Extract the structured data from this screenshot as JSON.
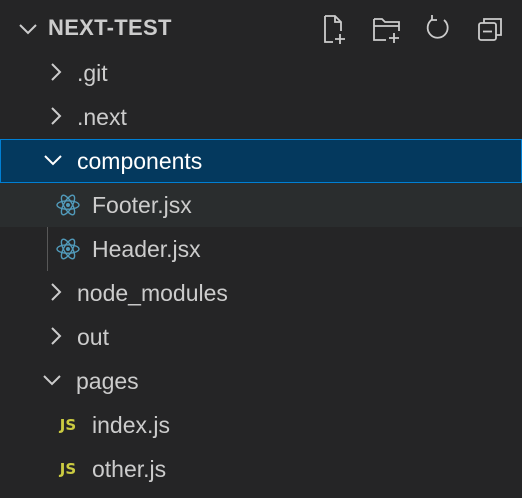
{
  "explorer": {
    "section_title": "NEXT-TEST",
    "actions": [
      {
        "name": "new-file",
        "icon": "new-file-icon"
      },
      {
        "name": "new-folder",
        "icon": "new-folder-icon"
      },
      {
        "name": "refresh",
        "icon": "refresh-icon"
      },
      {
        "name": "collapse-all",
        "icon": "collapse-all-icon"
      }
    ]
  },
  "tree": {
    "git": ".git",
    "next": ".next",
    "components": "components",
    "footer": "Footer.jsx",
    "header": "Header.jsx",
    "node_modules": "node_modules",
    "out": "out",
    "pages": "pages",
    "index": "index.js",
    "other": "other.js",
    "js_badge": "JS"
  },
  "colors": {
    "background": "#252526",
    "selected_background": "#04395e",
    "selected_border": "#007fd4",
    "react_icon": "#519aba",
    "js_icon": "#cbcb41"
  }
}
